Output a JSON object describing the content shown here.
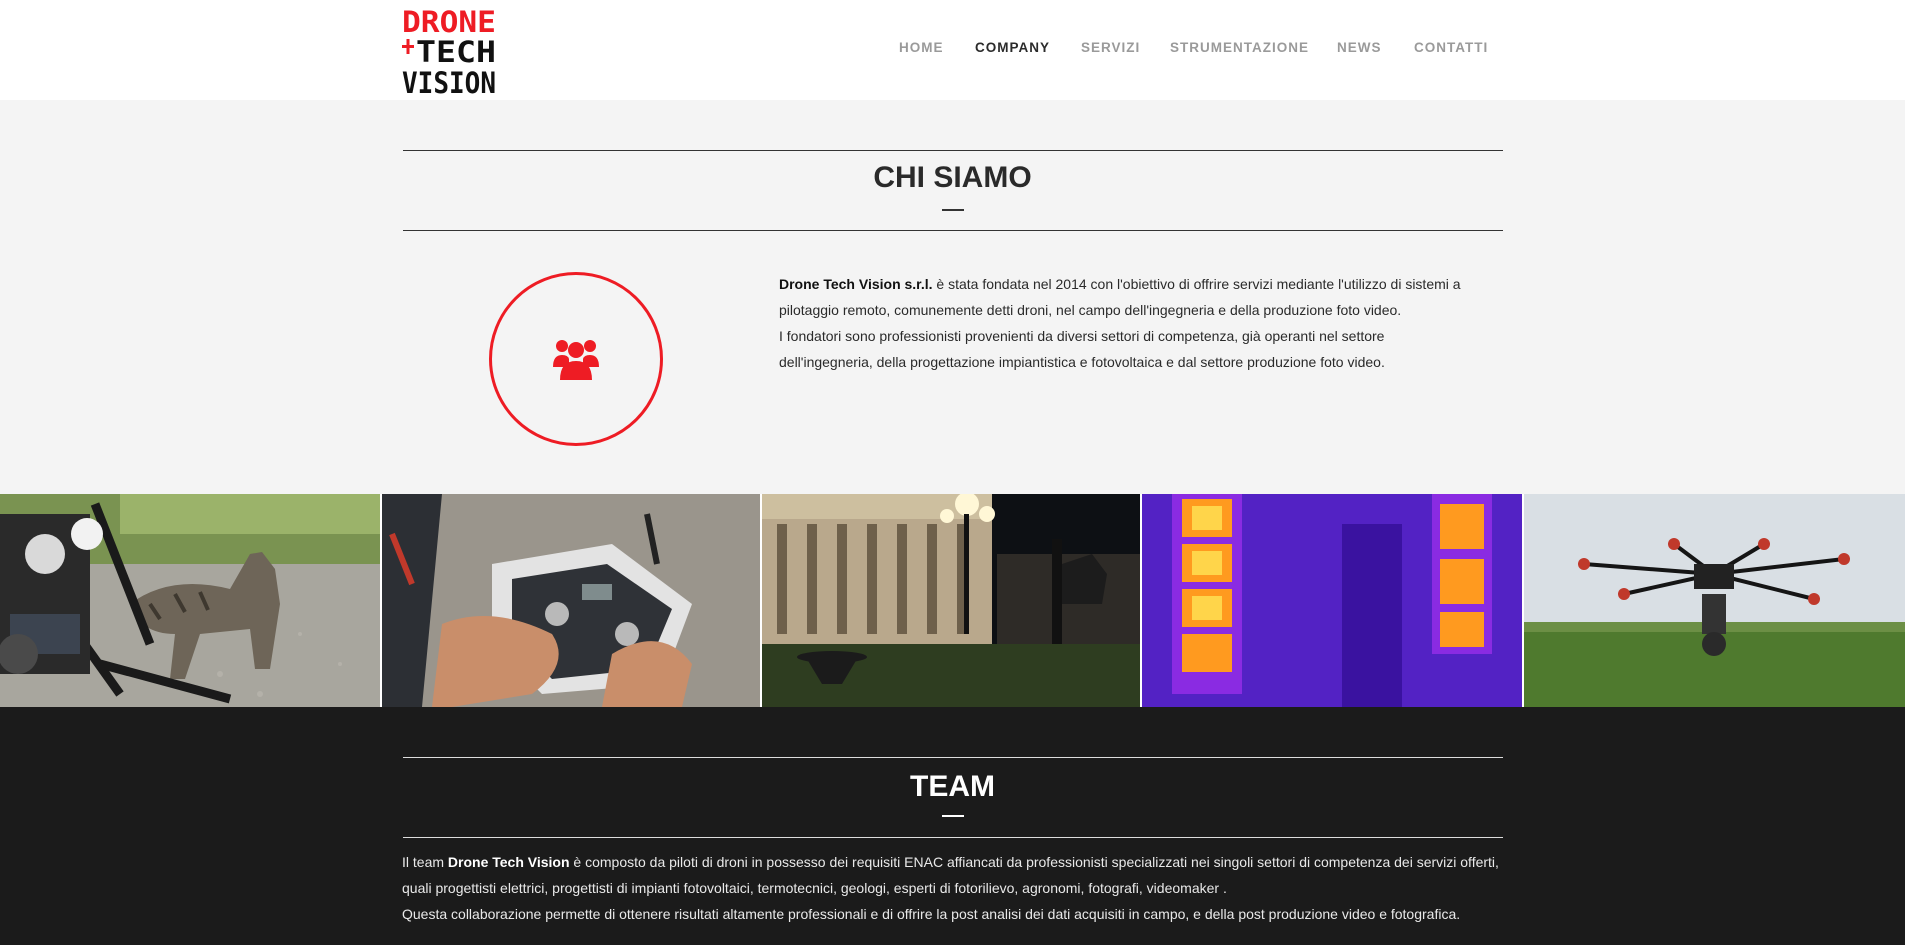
{
  "brand": {
    "logo_line1": "DRONE",
    "logo_line2": "TECH",
    "logo_line3": "VISION",
    "logo_alt": "Drone Tech Vision",
    "accent_color": "#ee1c24"
  },
  "nav": {
    "items": [
      {
        "label": "HOME",
        "active": false
      },
      {
        "label": "COMPANY",
        "active": true
      },
      {
        "label": "SERVIZI",
        "active": false
      },
      {
        "label": "STRUMENTAZIONE",
        "active": false
      },
      {
        "label": "NEWS",
        "active": false
      },
      {
        "label": "CONTATTI",
        "active": false
      }
    ]
  },
  "about": {
    "title": "CHI SIAMO",
    "icon": "users-icon",
    "company_name": "Drone Tech Vision s.r.l.",
    "paragraph_1_rest": " è stata fondata nel 2014 con l'obiettivo di offrire servizi mediante l'utilizzo di sistemi a pilotaggio remoto, comunemente detti droni, nel campo dell'ingegneria e della produzione foto video.",
    "paragraph_2": "I fondatori sono professionisti provenienti da diversi settori di competenza, già operanti nel settore dell'ingegneria, della progettazione impiantistica e fotovoltaica e dal settore produzione foto video."
  },
  "gallery": [
    {
      "subject": "cat-with-drone"
    },
    {
      "subject": "drone-remote-controller"
    },
    {
      "subject": "piazza-at-night-with-drone"
    },
    {
      "subject": "thermal-image-windows"
    },
    {
      "subject": "hexacopter-in-flight"
    }
  ],
  "team": {
    "title": "TEAM",
    "intro_prefix": "Il team ",
    "brand_name": "Drone Tech Vision",
    "paragraph_1_rest": " è composto da piloti di droni in possesso dei requisiti ENAC affiancati da professionisti specializzati nei singoli settori di competenza dei servizi offerti, quali progettisti elettrici, progettisti di impianti fotovoltaici, termotecnici, geologi, esperti di fotorilievo, agronomi, fotografi, videomaker .",
    "paragraph_2": "Questa collaborazione permette di ottenere risultati altamente professionali e di offrire la post analisi dei dati acquisiti in campo, e della post produzione video e fotografica."
  }
}
